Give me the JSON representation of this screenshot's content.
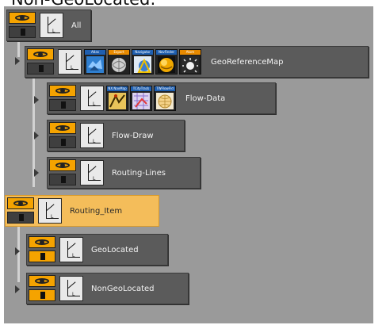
{
  "caption": "Non-GeoLocated:",
  "nodes": [
    {
      "name": "All",
      "thumbs": []
    },
    {
      "name": "GeoReferenceMap",
      "thumbs": [
        {
          "label": "Atlas",
          "label_color": "blue",
          "icon": "globe-map-icon"
        },
        {
          "label": "Export",
          "label_color": "orange",
          "icon": "sphere-icon"
        },
        {
          "label": "Navigator",
          "label_color": "blue",
          "icon": "globe-navigator-icon"
        },
        {
          "label": "NavFinder",
          "label_color": "blue",
          "icon": "golden-globe-icon"
        },
        {
          "label": "Atom",
          "label_color": "orange",
          "icon": "sunburst-icon"
        }
      ]
    },
    {
      "name": "Flow-Data",
      "thumbs": [
        {
          "label": "NX.NavMap",
          "label_color": "blue",
          "icon": "flow-map-icon"
        },
        {
          "label": "TCityTrack",
          "label_color": "blue",
          "icon": "city-map-icon"
        },
        {
          "label": "TWFlowFld",
          "label_color": "blue",
          "icon": "grid-globe-icon"
        }
      ]
    },
    {
      "name": "Flow-Draw",
      "thumbs": []
    },
    {
      "name": "Routing-Lines",
      "thumbs": []
    },
    {
      "name": "Routing_Item",
      "thumbs": [],
      "selected": true
    },
    {
      "name": "GeoLocated",
      "thumbs": []
    },
    {
      "name": "NonGeoLocated",
      "thumbs": []
    }
  ],
  "colors": {
    "panel": "#9a9a9a",
    "node": "#5b5b5b",
    "selected": "#f4bd5a",
    "eye_orange": "#f5a300"
  }
}
